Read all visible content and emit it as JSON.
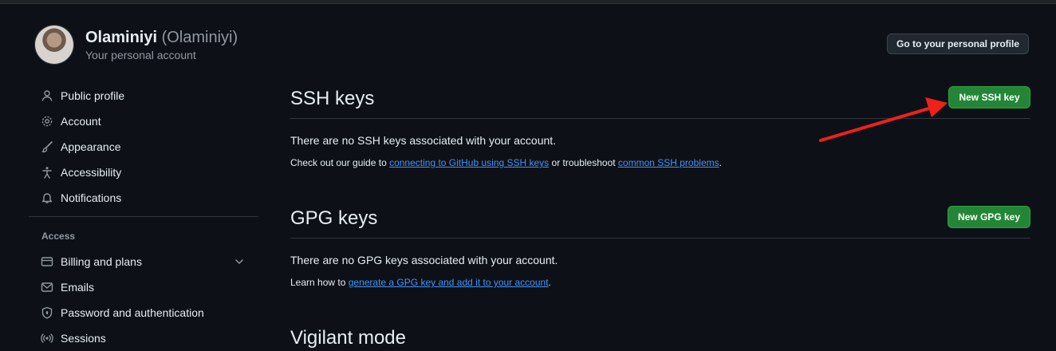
{
  "header": {
    "display_name": "Olaminiyi",
    "handle": "(Olaminiyi)",
    "subtitle": "Your personal account",
    "profile_button": "Go to your personal profile"
  },
  "sidebar": {
    "items": [
      {
        "label": "Public profile",
        "icon": "person-icon"
      },
      {
        "label": "Account",
        "icon": "gear-icon"
      },
      {
        "label": "Appearance",
        "icon": "paintbrush-icon"
      },
      {
        "label": "Accessibility",
        "icon": "accessibility-icon"
      },
      {
        "label": "Notifications",
        "icon": "bell-icon"
      }
    ],
    "access_label": "Access",
    "access_items": [
      {
        "label": "Billing and plans",
        "icon": "credit-card-icon"
      },
      {
        "label": "Emails",
        "icon": "mail-icon"
      },
      {
        "label": "Password and authentication",
        "icon": "shield-lock-icon"
      },
      {
        "label": "Sessions",
        "icon": "broadcast-icon"
      }
    ]
  },
  "ssh": {
    "title": "SSH keys",
    "new_button": "New SSH key",
    "empty": "There are no SSH keys associated with your account.",
    "guide_prefix": "Check out our guide to ",
    "guide_link": "connecting to GitHub using SSH keys",
    "guide_middle": " or troubleshoot ",
    "problems_link": "common SSH problems",
    "guide_suffix": "."
  },
  "gpg": {
    "title": "GPG keys",
    "new_button": "New GPG key",
    "empty": "There are no GPG keys associated with your account.",
    "learn_prefix": "Learn how to ",
    "learn_link": "generate a GPG key and add it to your account",
    "learn_suffix": "."
  },
  "vigilant": {
    "title": "Vigilant mode"
  },
  "colors": {
    "background": "#0d1117",
    "green_button": "#238636",
    "link": "#4493f8",
    "annotation_arrow": "#f0201a"
  }
}
